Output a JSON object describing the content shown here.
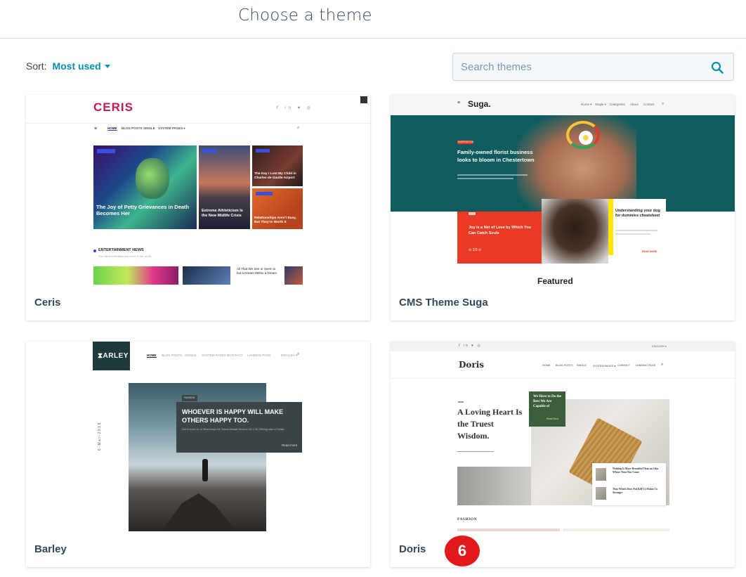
{
  "header": {
    "title": "Choose a theme"
  },
  "sort": {
    "label": "Sort:",
    "value": "Most used"
  },
  "search": {
    "placeholder": "Search themes"
  },
  "themes": [
    {
      "name": "Ceris",
      "preview": {
        "logo": "CERIS",
        "nav": [
          "HOME",
          "BLOG POSTS",
          "SINGLE",
          "SYSTEM PAGES ▾"
        ],
        "hero_title": "The Joy of Petty Grievances in Death Becomes Her",
        "card2_title": "Extreme Athleticism Is the New Midlife Crisis",
        "card3_title": "The Day I Lost My Child in Charles de Gaulle Airport",
        "card4_title": "Relationships Aren't Easy, But They're Worth It",
        "section": "ENTERTAINMENT NEWS",
        "section_sub": "The latest entertainment news in the world",
        "list_title": "All That We See or Seem is but a Dream Within a Dream"
      }
    },
    {
      "name": "CMS Theme Suga",
      "preview": {
        "logo": "Suga.",
        "nav": [
          "Home ▾",
          "Single ▾",
          "Categories",
          "About",
          "Contact"
        ],
        "tag": "INSPIRATION",
        "hero_title": "Family-owned florist business looks to bloom in Chestertown",
        "red_title": "Joy is a Net of Love by Which You Can Catch Souls",
        "pager": "1/3",
        "side_title": "Understanding your dog for dummies cheatsheet",
        "read_more": "READ MORE",
        "featured": "Featured"
      }
    },
    {
      "name": "Barley",
      "preview": {
        "logo": "ARLEY",
        "nav": [
          "HOME",
          "BLOG POSTS",
          "SINGLE",
          "SYSTEM PAGES ▾",
          "CONTACT",
          "LANDING PAGE",
          "ENGLISH ▾"
        ],
        "date": "6-Mar-2019",
        "tag": "FASHION",
        "hero_title": "WHOEVER IS HAPPY WILL MAKE OTHERS HAPPY TOO.",
        "excerpt": "Get In touch Jo, is What keeps the Teams lifestyle Bench in 3D 1.35 Offering cake of Dallas.",
        "read_more": "Read more"
      }
    },
    {
      "name": "Doris",
      "preview": {
        "logo": "Doris",
        "lang": "ENGLISH ▾",
        "nav": [
          "HOME",
          "BLOG POSTS",
          "SINGLE",
          "SYSTEM PAGES ▾",
          "CONTACT",
          "LANDING PAGE"
        ],
        "hero_title": "A Loving Heart Is the Truest Wisdom.",
        "green_title": "We Have to Do the Best We Are Capable of",
        "read_more": "Read More",
        "item1": "Nothing Is More Beautiful Than an Idea Whose Time Has Come",
        "item2": "That Which Does Not Kill Us Makes Us Stronger",
        "section": "FASHION"
      }
    }
  ],
  "overlay_badge": "6",
  "colors": {
    "link": "#0091ae",
    "text": "#33475b",
    "badge": "#e01a1a",
    "suga_teal": "#0f5b5e",
    "suga_red": "#ea3a24",
    "doris_green": "#3a5f3a"
  }
}
